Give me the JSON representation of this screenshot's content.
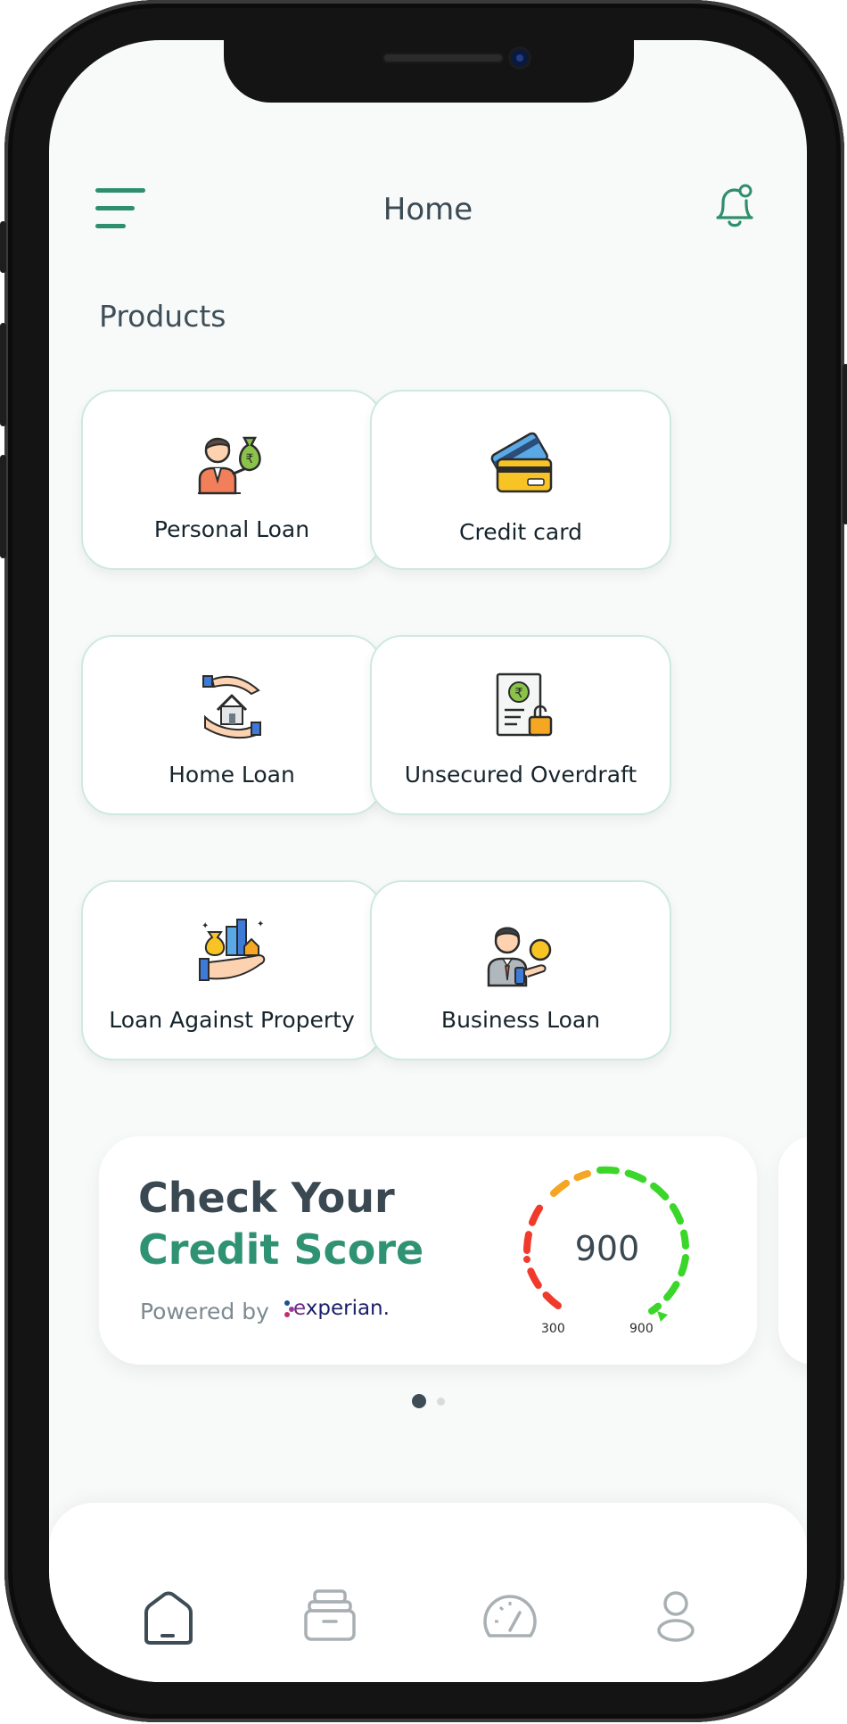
{
  "header": {
    "title": "Home"
  },
  "products": {
    "title": "Products",
    "items": [
      {
        "label": "Personal Loan",
        "icon": "personal-loan-icon"
      },
      {
        "label": "Credit card",
        "icon": "credit-card-icon"
      },
      {
        "label": "Home Loan",
        "icon": "home-loan-icon"
      },
      {
        "label": "Unsecured Overdraft",
        "icon": "overdraft-icon"
      },
      {
        "label": "Loan Against Property",
        "icon": "property-loan-icon"
      },
      {
        "label": "Business Loan",
        "icon": "business-loan-icon"
      }
    ]
  },
  "credit_score_card": {
    "title_line1": "Check Your",
    "title_line2": "Credit Score",
    "powered_by": "Powered by",
    "provider_x": "e",
    "provider_rest": "xperian.",
    "score": "900",
    "min_label": "300",
    "max_label": "900"
  },
  "carousel": {
    "active_page": 1,
    "page_count": 2
  },
  "bottom_nav": {
    "items": [
      {
        "icon": "home-icon",
        "active": true
      },
      {
        "icon": "products-tray-icon",
        "active": false
      },
      {
        "icon": "speedometer-icon",
        "active": false
      },
      {
        "icon": "profile-icon",
        "active": false
      }
    ]
  },
  "colors": {
    "accent": "#2f9273",
    "text_dark": "#3a4852",
    "card_border": "#cfe9de",
    "gauge_red": "#f03b2c",
    "gauge_orange": "#f5a623",
    "gauge_green": "#3ad72a",
    "nav_inactive": "#a9b0b4"
  }
}
